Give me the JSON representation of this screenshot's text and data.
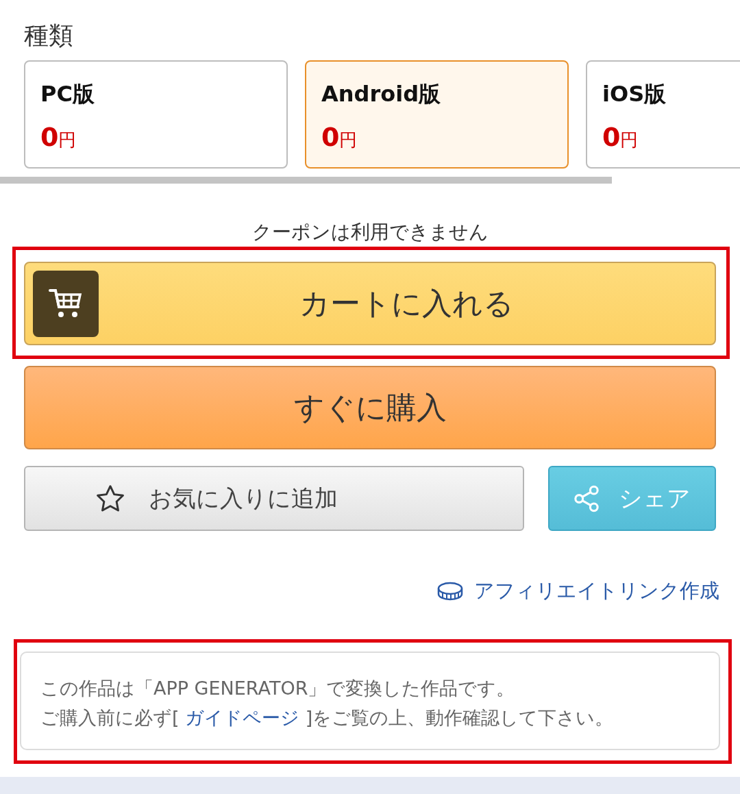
{
  "section_title": "種類",
  "variants": [
    {
      "name": "PC版",
      "price": "0",
      "currency": "円",
      "selected": false
    },
    {
      "name": "Android版",
      "price": "0",
      "currency": "円",
      "selected": true
    },
    {
      "name": "iOS版",
      "price": "0",
      "currency": "円",
      "selected": false
    }
  ],
  "coupon_note": "クーポンは利用できません",
  "cart_button": {
    "label": "カートに入れる",
    "highlighted": true
  },
  "buy_button": {
    "label": "すぐに購入"
  },
  "favorite_button": {
    "label": "お気に入りに追加"
  },
  "share_button": {
    "label": "シェア"
  },
  "affiliate_link": "アフィリエイトリンク作成",
  "notice": {
    "highlighted": true,
    "line_1": "この作品は「APP GENERATOR」で変換した作品です。",
    "line_2_before": "ご購入前に必ず[ ",
    "line_2_link": "ガイドページ",
    "line_2_after": " ]をご覧の上、動作確認して下さい。"
  }
}
